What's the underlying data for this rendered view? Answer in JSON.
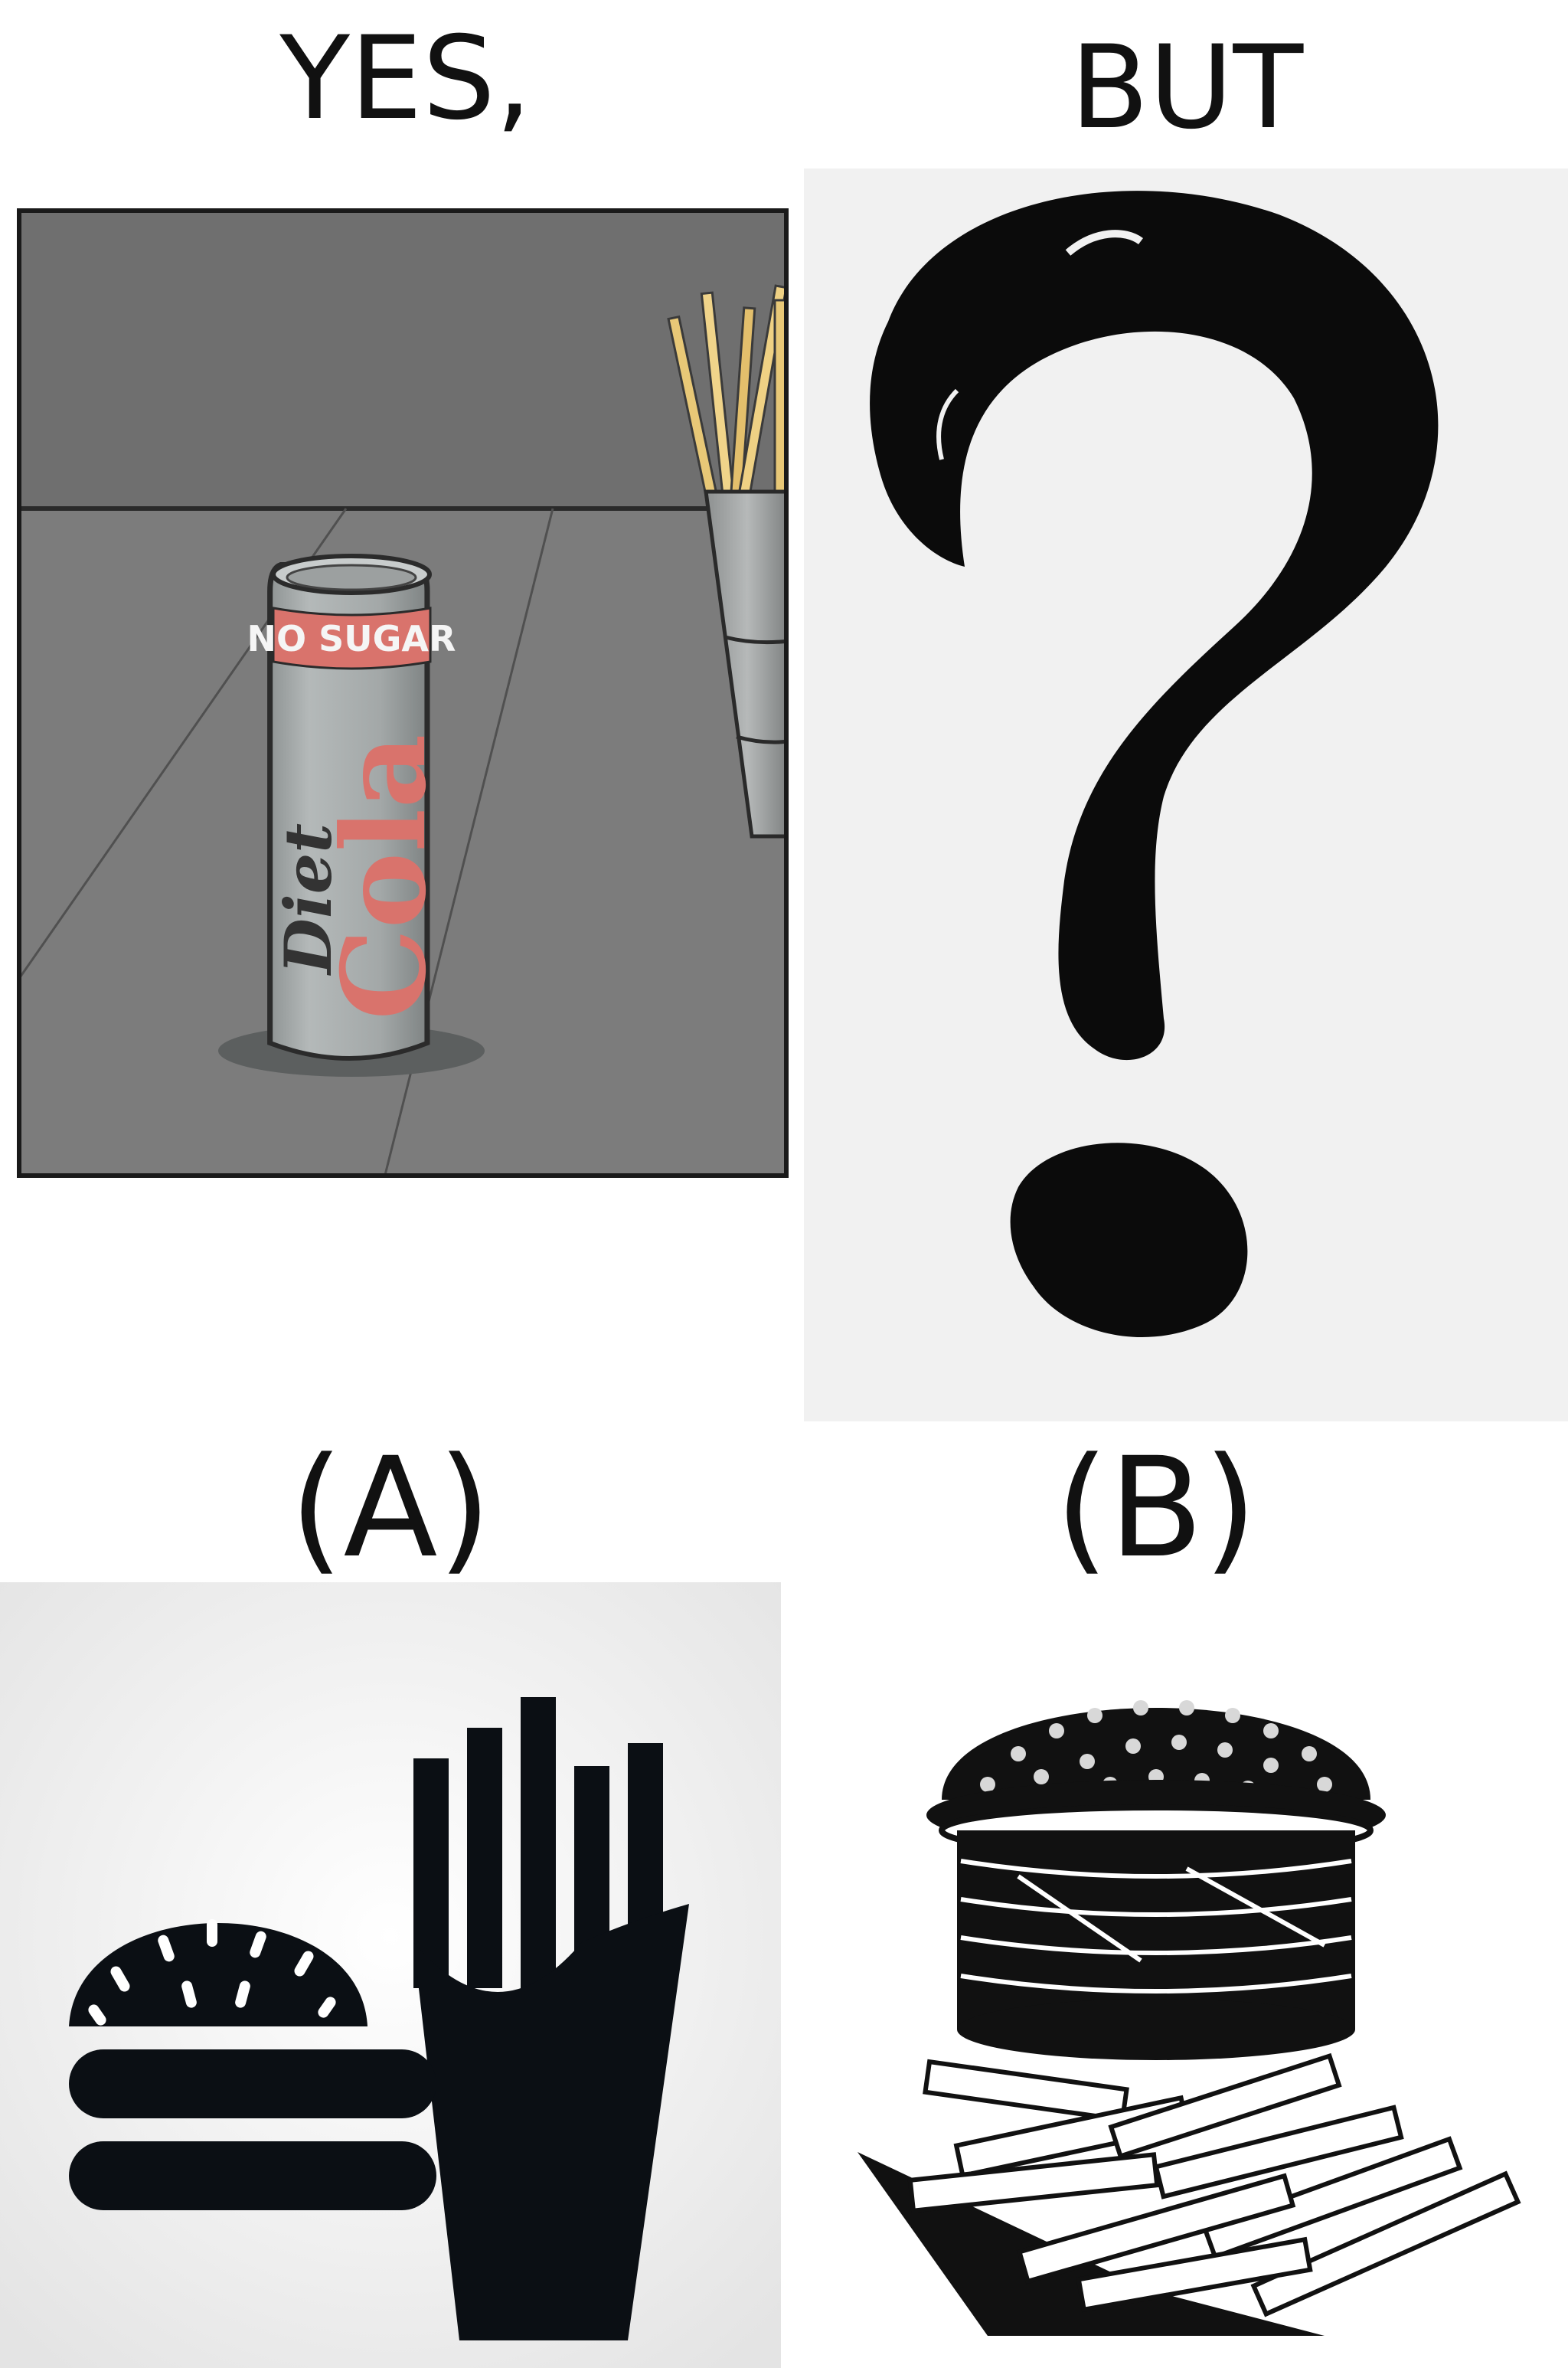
{
  "headings": {
    "yes": "YES,",
    "but": "BUT",
    "option_a": "(A)",
    "option_b": "(B)"
  },
  "can": {
    "band_text": "NO SUGAR",
    "label_diet": "Diet",
    "label_cola": "Cola"
  },
  "colors": {
    "text": "#111111",
    "scene_wall": "#6f6f6f",
    "scene_floor": "#7e7e7e",
    "can_body": "#a9aeae",
    "can_red": "#d9736c",
    "ink_black": "#0b0f14",
    "fries_yellow": "#e8c877"
  }
}
